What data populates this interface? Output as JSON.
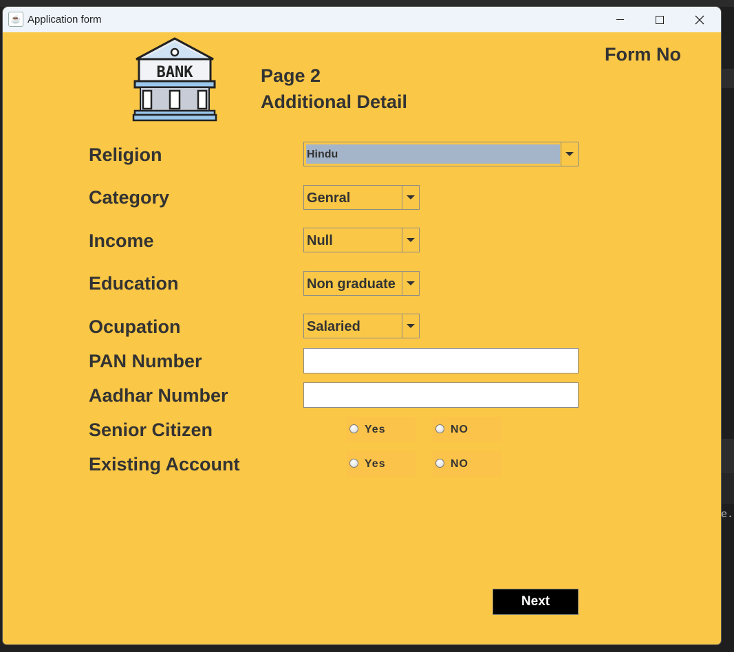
{
  "window": {
    "title": "Application form"
  },
  "header": {
    "page": "Page 2",
    "subtitle": "Additional Detail",
    "form_no": "Form No",
    "logo_text": "BANK"
  },
  "form": {
    "religion": {
      "label": "Religion",
      "value": "Hindu"
    },
    "category": {
      "label": "Category",
      "value": "Genral"
    },
    "income": {
      "label": "Income",
      "value": "Null"
    },
    "education": {
      "label": "Education",
      "value": "Non graduate"
    },
    "occupation": {
      "label": "Ocupation",
      "value": "Salaried"
    },
    "pan": {
      "label": "PAN Number",
      "value": ""
    },
    "aadhar": {
      "label": "Aadhar Number",
      "value": ""
    },
    "senior_citizen": {
      "label": "Senior Citizen",
      "yes": "Yes",
      "no": "NO"
    },
    "existing_account": {
      "label": "Existing Account",
      "yes": "Yes",
      "no": "NO"
    }
  },
  "actions": {
    "next": "Next"
  },
  "colors": {
    "background": "#fac746",
    "selected_combo": "#a4b5c9",
    "next_button": "#000000"
  },
  "icons": [
    "java-app-icon",
    "bank-logo-icon",
    "minimize-icon",
    "maximize-icon",
    "close-icon",
    "dropdown-arrow-icon",
    "radio-icon"
  ]
}
